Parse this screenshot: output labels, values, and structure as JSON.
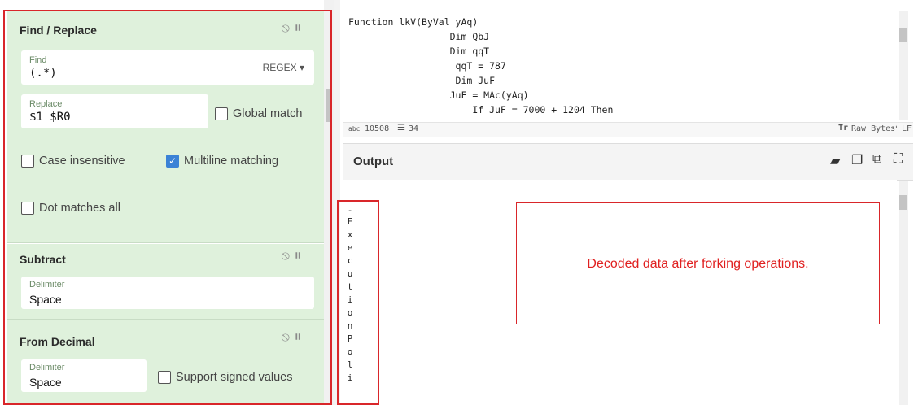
{
  "recipe": {
    "find_replace": {
      "title": "Find / Replace",
      "find_label": "Find",
      "find_value": "(.*)",
      "find_mode": "REGEX",
      "replace_label": "Replace",
      "replace_value": "$1 $R0",
      "global_match_label": "Global match",
      "global_match": false,
      "case_insensitive_label": "Case insensitive",
      "case_insensitive": false,
      "multiline_label": "Multiline matching",
      "multiline": true,
      "dot_matches_all_label": "Dot matches all",
      "dot_matches_all": false
    },
    "subtract": {
      "title": "Subtract",
      "delimiter_label": "Delimiter",
      "delimiter_value": "Space"
    },
    "from_decimal": {
      "title": "From Decimal",
      "delimiter_label": "Delimiter",
      "delimiter_value": "Space",
      "signed_label": "Support signed values",
      "signed": false
    },
    "icons": [
      "disable-icon",
      "pause-icon"
    ]
  },
  "input": {
    "lines": [
      "Function lkV(ByVal yAq)",
      "                  Dim QbJ",
      "                  Dim qqT",
      "                   qqT = 787",
      "                   Dim JuF",
      "                  JuF = MAc(yAq)",
      "                      If JuF = 7000 + 1204 Then"
    ],
    "stats_length": "10508",
    "stats_lines": "34",
    "raw_bytes_label": "Raw Bytes",
    "eol_label": "LF"
  },
  "output": {
    "title": "Output",
    "chars": [
      "-",
      "E",
      "x",
      "e",
      "c",
      "u",
      "t",
      "i",
      "o",
      "n",
      "P",
      "o",
      "l",
      "i"
    ],
    "annotation": "Decoded data after forking operations."
  },
  "colors": {
    "accent_green": "#dff1dc",
    "annotation_red": "#d9262a",
    "checkbox_blue": "#3b82d6"
  }
}
